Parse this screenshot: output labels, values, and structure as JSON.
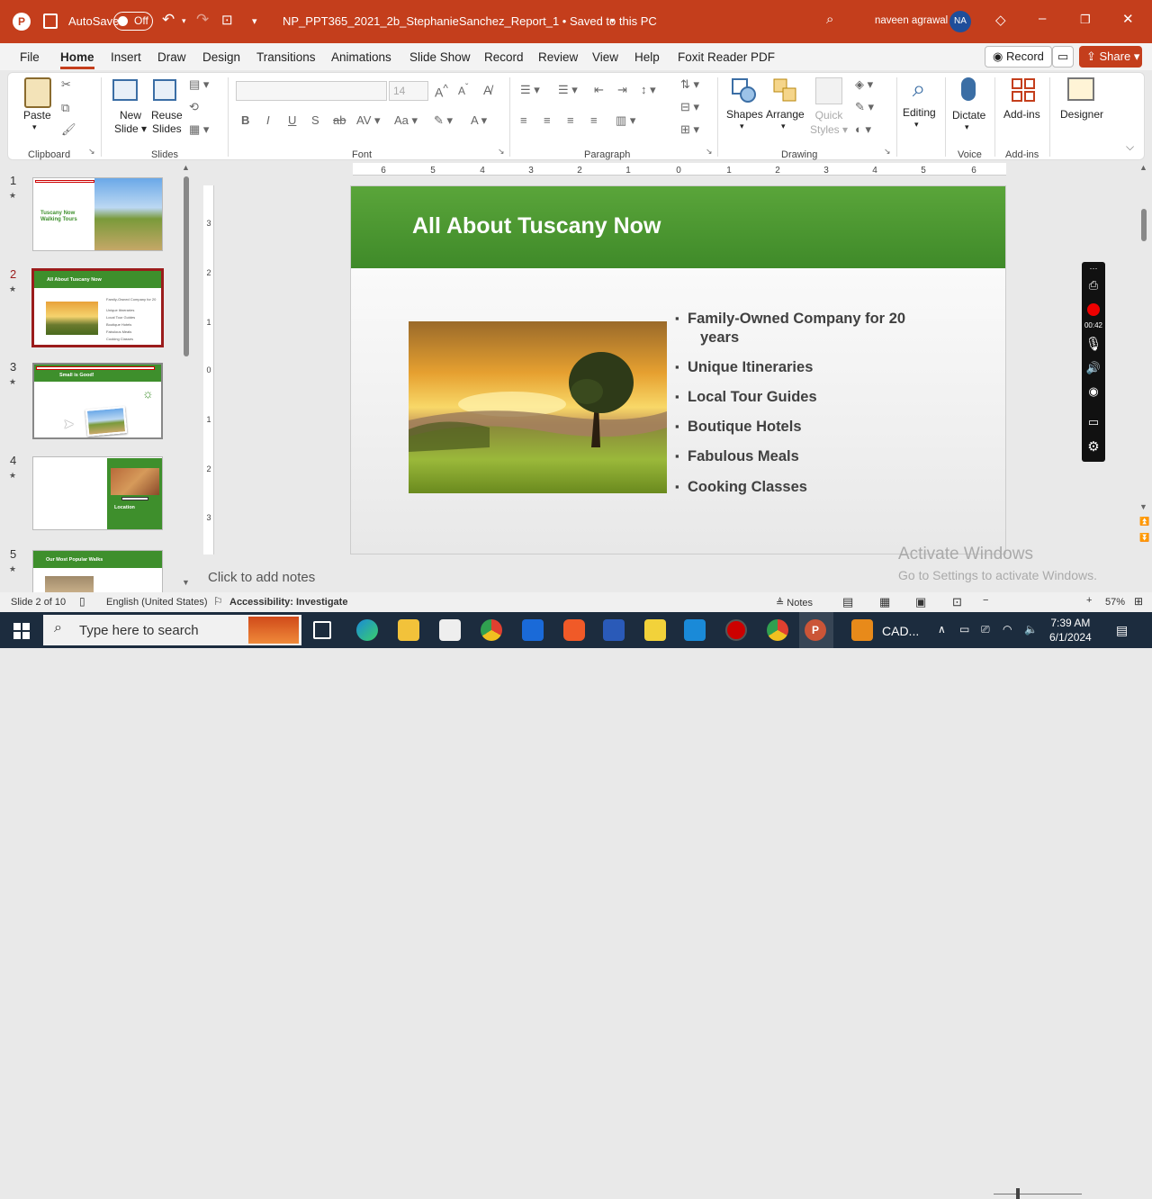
{
  "titlebar": {
    "autosave_label": "AutoSave",
    "autosave_state": "Off",
    "doc_title": "NP_PPT365_2021_2b_StephanieSanchez_Report_1 • Saved to this PC",
    "user_name": "naveen agrawal",
    "user_initials": "NA"
  },
  "menu": {
    "items": [
      "File",
      "Home",
      "Insert",
      "Draw",
      "Design",
      "Transitions",
      "Animations",
      "Slide Show",
      "Record",
      "Review",
      "View",
      "Help",
      "Foxit Reader PDF"
    ],
    "active": "Home",
    "record_label": "Record",
    "share_label": "Share"
  },
  "ribbon": {
    "paste": "Paste",
    "new_slide": [
      "New",
      "Slide"
    ],
    "reuse_slides": [
      "Reuse",
      "Slides"
    ],
    "font_size": "14",
    "shapes": "Shapes",
    "arrange": "Arrange",
    "quick_styles": [
      "Quick",
      "Styles"
    ],
    "editing": "Editing",
    "dictate": "Dictate",
    "addins": "Add-ins",
    "designer": "Designer",
    "groups": {
      "clipboard": "Clipboard",
      "slides": "Slides",
      "font": "Font",
      "paragraph": "Paragraph",
      "drawing": "Drawing",
      "voice": "Voice",
      "addins": "Add-ins"
    }
  },
  "thumbnails": [
    {
      "num": "1",
      "title": "Tuscany Now Walking Tours"
    },
    {
      "num": "2",
      "title": "All About Tuscany Now"
    },
    {
      "num": "3",
      "title": "Small is Good!"
    },
    {
      "num": "4",
      "title": "Location"
    },
    {
      "num": "5",
      "title": "Our Most Popular Walks"
    }
  ],
  "slide": {
    "title": "All About Tuscany Now",
    "bullets": [
      "Family-Owned Company for 20",
      "years",
      "Unique Itineraries",
      "Local Tour Guides",
      "Boutique Hotels",
      "Fabulous Meals",
      "Cooking Classes"
    ]
  },
  "notes_placeholder": "Click to add notes",
  "recorder": {
    "time": "00:42"
  },
  "watermark": {
    "line1": "Activate Windows",
    "line2": "Go to Settings to activate Windows."
  },
  "statusbar": {
    "slide_info": "Slide 2 of 10",
    "language": "English (United States)",
    "accessibility": "Accessibility: Investigate",
    "notes": "Notes",
    "zoom": "57%"
  },
  "taskbar": {
    "search_placeholder": "Type here to search",
    "app_label": "CAD...",
    "time": "7:39 AM",
    "date": "6/1/2024"
  },
  "colors": {
    "accent": "#c43e1c",
    "slide_green": "#3f8a29",
    "taskbar": "#1c2c3e"
  }
}
